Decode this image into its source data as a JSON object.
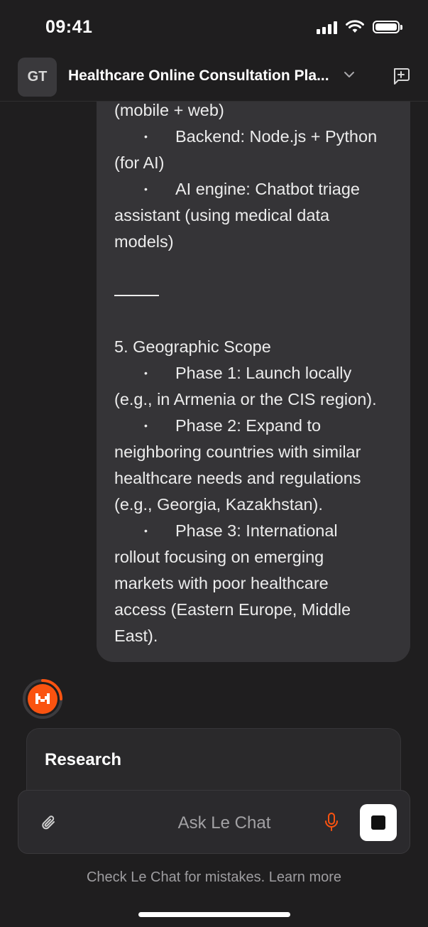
{
  "status_bar": {
    "time": "09:41"
  },
  "header": {
    "avatar_initials": "GT",
    "title": "Healthcare Online Consultation Pla...",
    "chevron_icon": "chevron-down-icon",
    "new_chat_icon": "new-chat-icon"
  },
  "message": {
    "lines": [
      {
        "type": "text",
        "text": "(mobile + web)"
      },
      {
        "type": "bullet",
        "text": "Backend: Node.js + Python"
      },
      {
        "type": "text",
        "text": "(for AI)"
      },
      {
        "type": "bullet",
        "text": "AI engine: Chatbot triage"
      },
      {
        "type": "text",
        "text": "assistant (using medical data"
      },
      {
        "type": "text",
        "text": "models)"
      },
      {
        "type": "blank",
        "text": ""
      },
      {
        "type": "rule",
        "text": ""
      },
      {
        "type": "blank",
        "text": ""
      },
      {
        "type": "text",
        "text": "5. Geographic Scope"
      },
      {
        "type": "bullet",
        "text": "Phase 1: Launch locally"
      },
      {
        "type": "text",
        "text": "(e.g., in Armenia or the CIS region)."
      },
      {
        "type": "bullet",
        "text": "Phase 2: Expand to"
      },
      {
        "type": "text",
        "text": "neighboring countries with similar"
      },
      {
        "type": "text",
        "text": "healthcare needs and regulations"
      },
      {
        "type": "text",
        "text": "(e.g., Georgia, Kazakhstan)."
      },
      {
        "type": "bullet",
        "text": "Phase 3: International"
      },
      {
        "type": "text",
        "text": "rollout focusing on emerging"
      },
      {
        "type": "text",
        "text": "markets with poor healthcare"
      },
      {
        "type": "text",
        "text": "access (Eastern Europe, Middle"
      },
      {
        "type": "text",
        "text": "East)."
      }
    ]
  },
  "assistant": {
    "avatar_icon": "le-chat-logo-icon",
    "accent": "#fa5310"
  },
  "research_card": {
    "label": "Research"
  },
  "composer": {
    "placeholder": "Ask Le Chat",
    "attach_icon": "paperclip-icon",
    "mic_icon": "microphone-icon",
    "stop_icon": "stop-icon"
  },
  "footer": {
    "disclaimer": "Check Le Chat for mistakes. Learn more"
  }
}
